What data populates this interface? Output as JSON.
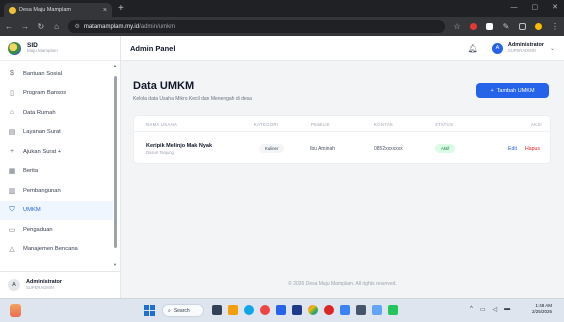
{
  "browser": {
    "tab_title": "Desa Maju Mamplam",
    "tab_close": "×",
    "new_tab": "+",
    "url_host": "matamamplam.my.id",
    "url_path": "/admin/umkm",
    "window_controls": [
      "—",
      "▢",
      "✕"
    ]
  },
  "sidebar": {
    "brand_title": "SID",
    "brand_subtitle": "Maju Mamplam",
    "items": [
      {
        "label": "Bantuan Sosial",
        "icon": "dollar-icon",
        "glyph": "$"
      },
      {
        "label": "Program Bansos",
        "icon": "clipboard-icon",
        "glyph": "▯"
      },
      {
        "label": "Data Rumah",
        "icon": "home-icon",
        "glyph": "⌂"
      },
      {
        "label": "Layanan Surat",
        "icon": "document-icon",
        "glyph": "▤"
      },
      {
        "label": "Ajukan Surat +",
        "icon": "plus-icon",
        "glyph": "+"
      },
      {
        "label": "Berita",
        "icon": "newspaper-icon",
        "glyph": "▦"
      },
      {
        "label": "Pembangunan",
        "icon": "building-icon",
        "glyph": "▥"
      },
      {
        "label": "UMKM",
        "icon": "store-icon",
        "glyph": "⛉"
      },
      {
        "label": "Pengaduan",
        "icon": "chat-icon",
        "glyph": "▭"
      },
      {
        "label": "Manajemen Bencana",
        "icon": "warning-icon",
        "glyph": "△"
      }
    ],
    "user": {
      "initial": "A",
      "name": "Administrator",
      "role": "SUPERADMIN"
    }
  },
  "header": {
    "title": "Admin Panel",
    "user_initial": "A",
    "user_name": "Administrator",
    "user_role": "SUPERADMIN"
  },
  "page": {
    "title": "Data UMKM",
    "subtitle": "Kelola data Usaha Mikro Kecil dan Menengah di desa",
    "add_button": "Tambah UMKM"
  },
  "table": {
    "columns": [
      "NAMA USAHA",
      "KATEGORI",
      "PEMILIK",
      "KONTAK",
      "STATUS",
      "AKSI"
    ],
    "rows": [
      {
        "name": "Keripik Melinjo Mak Nyak",
        "address": "Dusun Tanjung",
        "category": "Kuliner",
        "owner": "Ibu Aminah",
        "contact": "0852xxxxxxx",
        "status": "Aktif",
        "edit": "Edit",
        "delete": "Hapus"
      }
    ]
  },
  "footer": "© 2026 Desa Maju Mamplam. All rights reserved.",
  "taskbar": {
    "search": "Search",
    "time": "1:48 AM",
    "date": "2/25/2026"
  },
  "colors": {
    "accent": "#2563eb",
    "danger": "#dc2626",
    "success": "#15803d"
  }
}
